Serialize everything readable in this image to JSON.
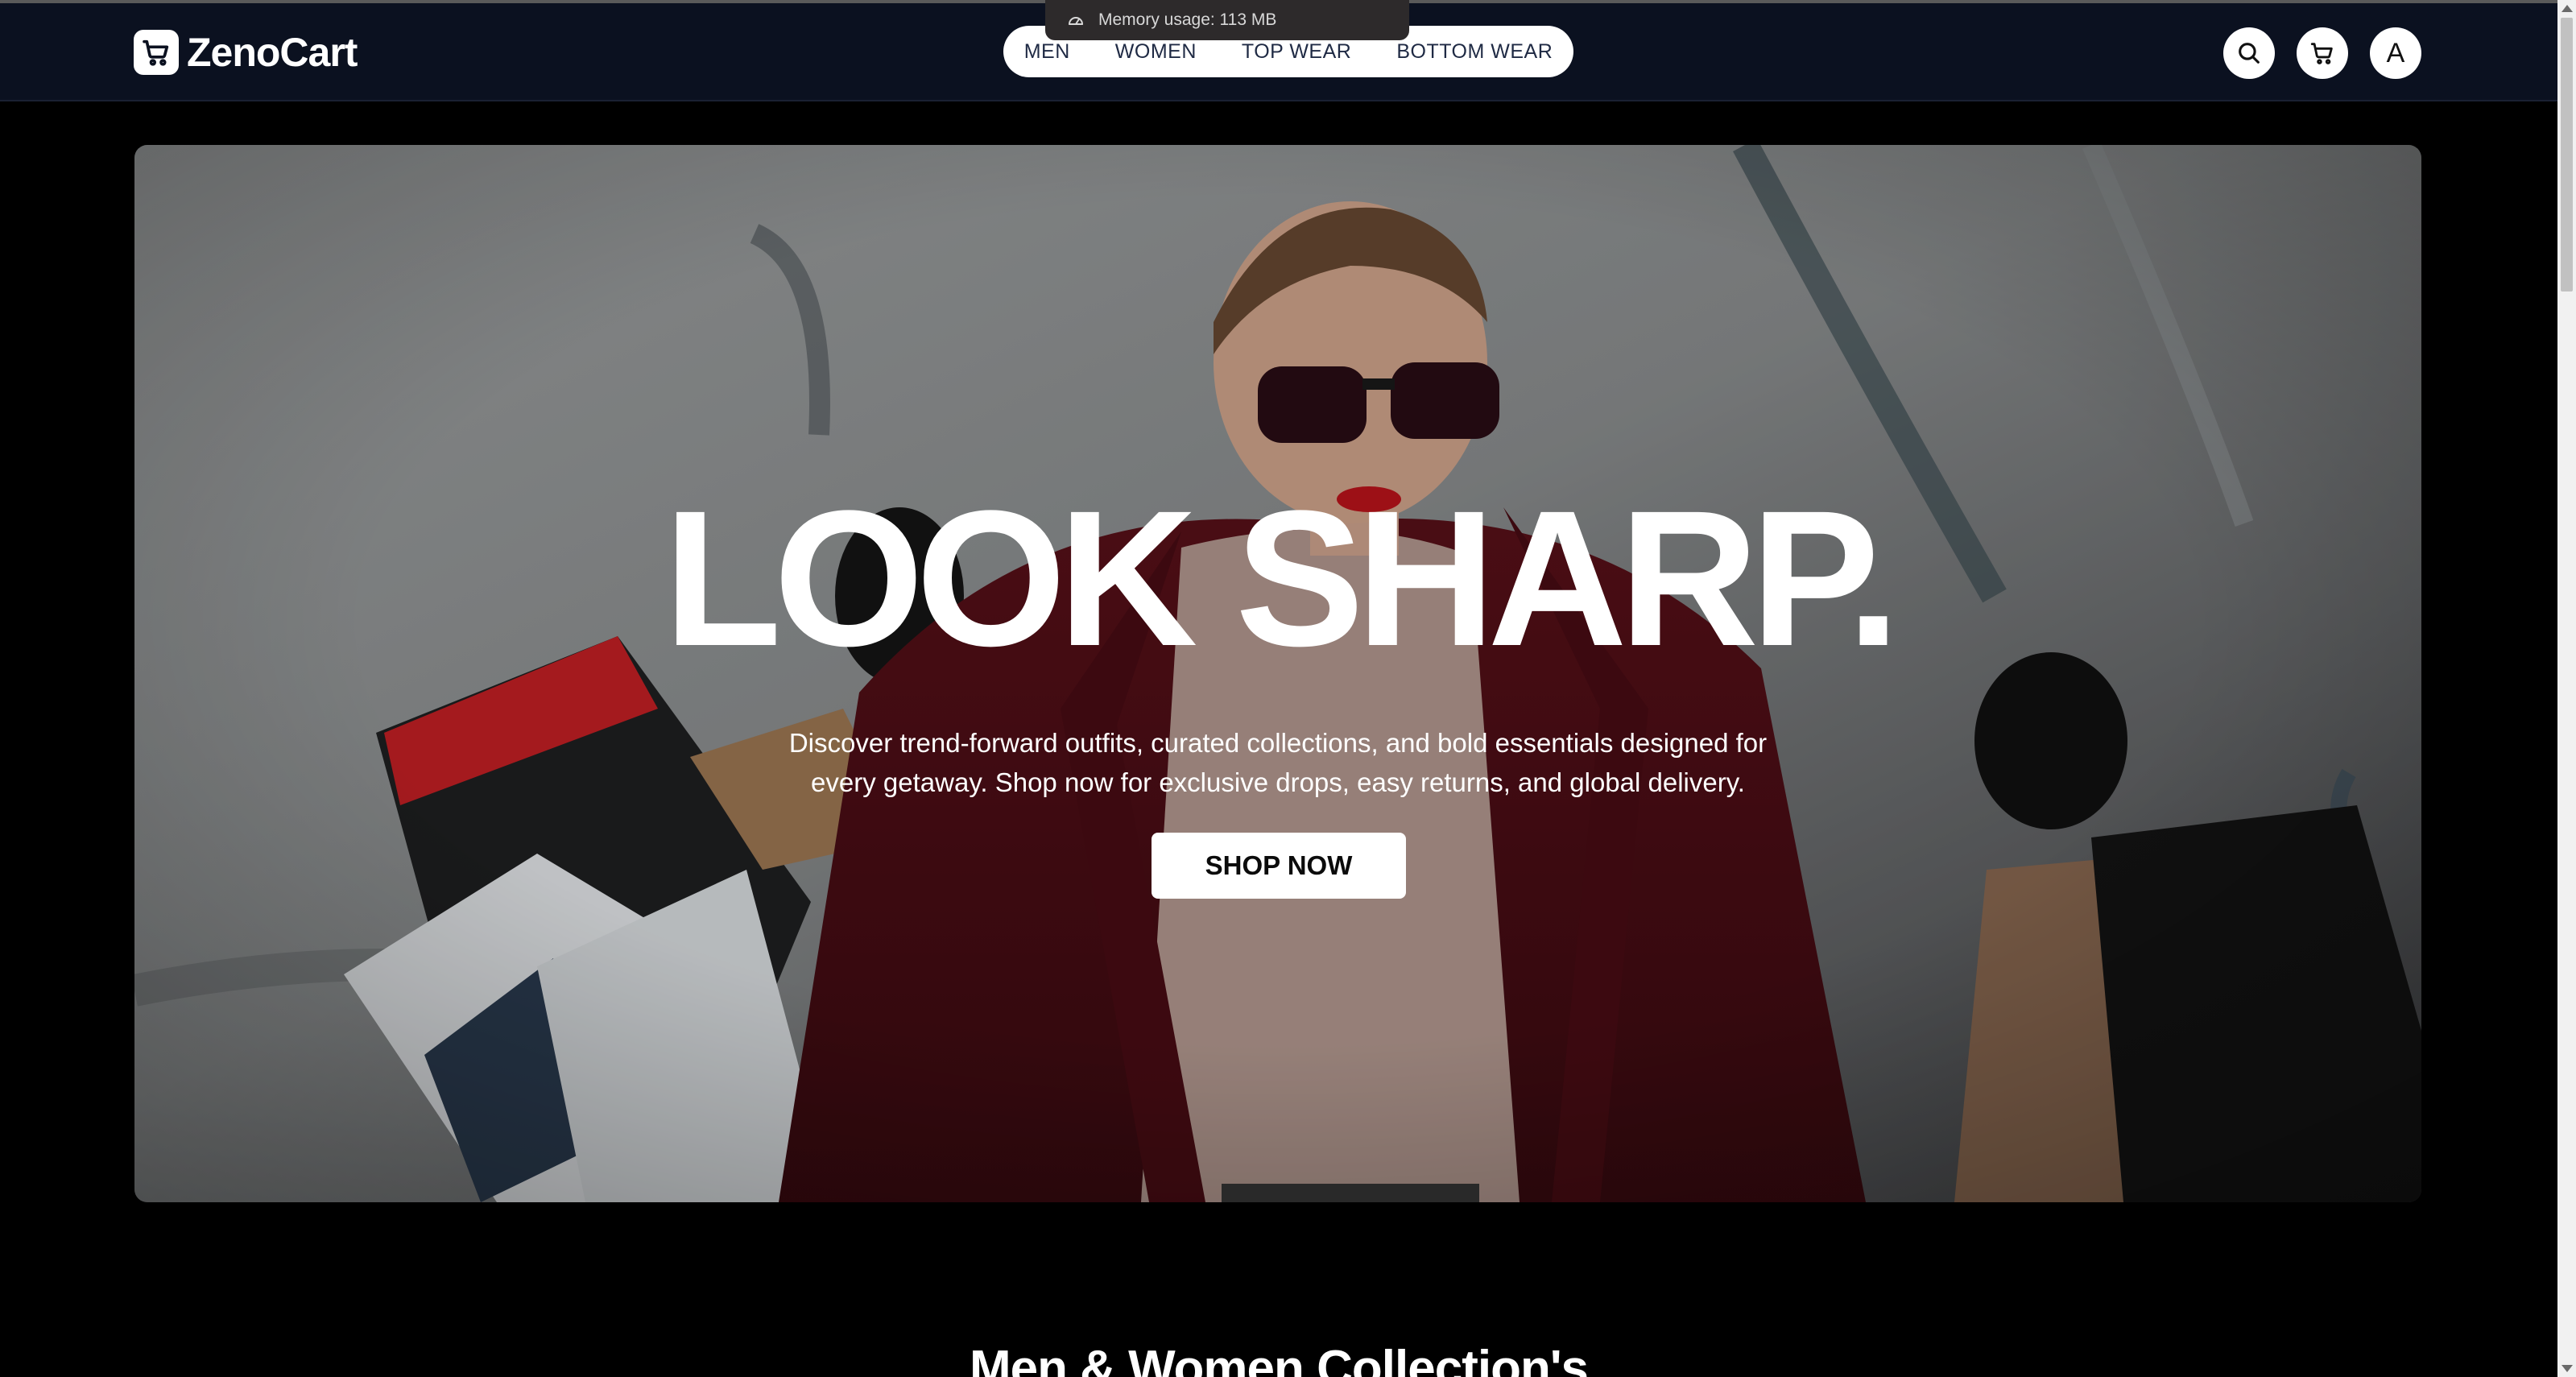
{
  "system": {
    "memory_usage": "Memory usage: 113 MB"
  },
  "brand": {
    "name": "ZenoCart"
  },
  "nav": {
    "links": [
      {
        "label": "MEN"
      },
      {
        "label": "WOMEN"
      },
      {
        "label": "TOP WEAR"
      },
      {
        "label": "BOTTOM WEAR"
      }
    ]
  },
  "header_actions": {
    "search_icon": "search-icon",
    "cart_icon": "cart-icon",
    "avatar_initial": "A"
  },
  "hero": {
    "title": "LOOK SHARP.",
    "subtitle": "Discover trend-forward outfits, curated collections, and bold essentials designed for every getaway. Shop now for exclusive drops, easy returns, and global delivery.",
    "cta_label": "SHOP NOW"
  },
  "sections": {
    "collections_heading": "Men & Women Collection's"
  },
  "colors": {
    "navbar_bg": "#0b1120",
    "page_bg": "#000000",
    "accent_white": "#ffffff",
    "coat_red": "#6b1220"
  }
}
